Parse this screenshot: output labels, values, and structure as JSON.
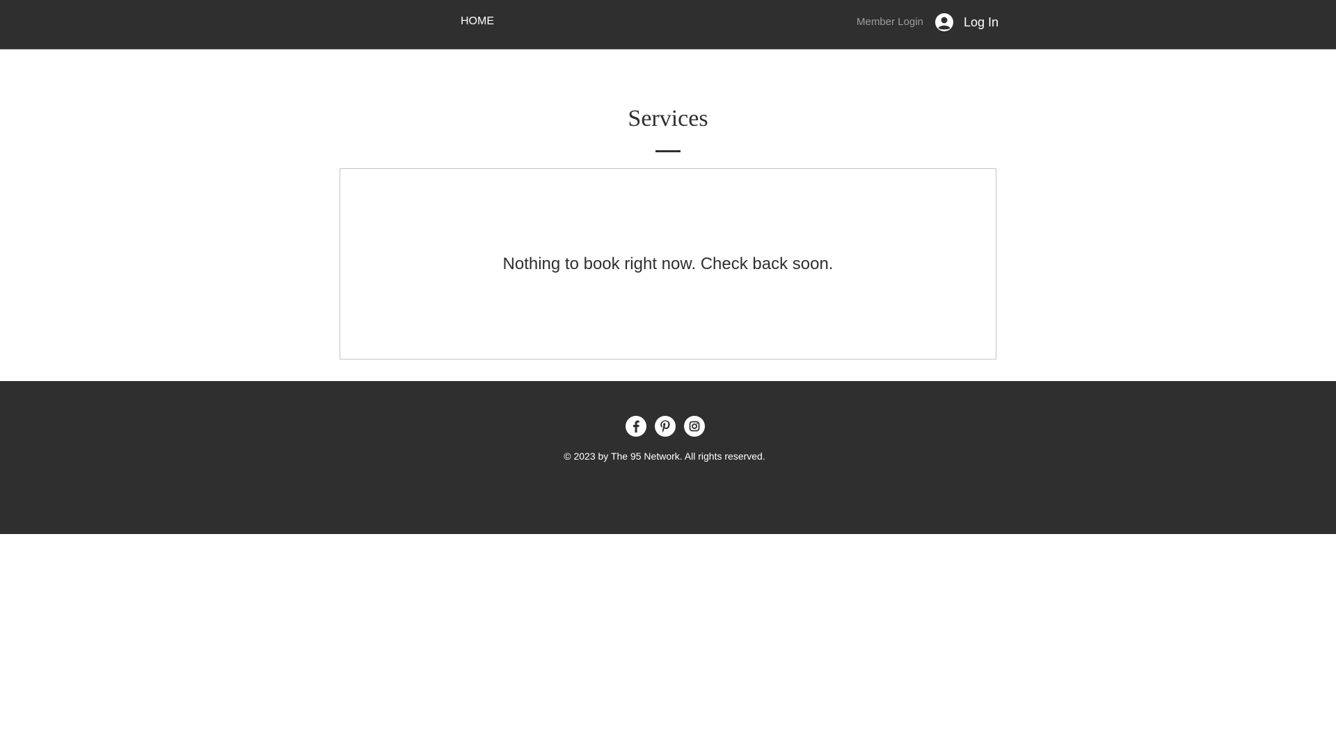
{
  "header": {
    "nav": {
      "home_label": "HOME"
    },
    "member_login_label": "Member Login",
    "login_button_label": "Log In",
    "background_color": "#2f2f2f"
  },
  "main": {
    "title": "Services",
    "empty_message": "Nothing to book right now. Check back soon."
  },
  "footer": {
    "social_icons": [
      "facebook-icon",
      "pinterest-icon",
      "instagram-icon"
    ],
    "copyright": "© 2023 by The 95 Network. All rights reserved.",
    "background_color": "#2f2f2f"
  }
}
